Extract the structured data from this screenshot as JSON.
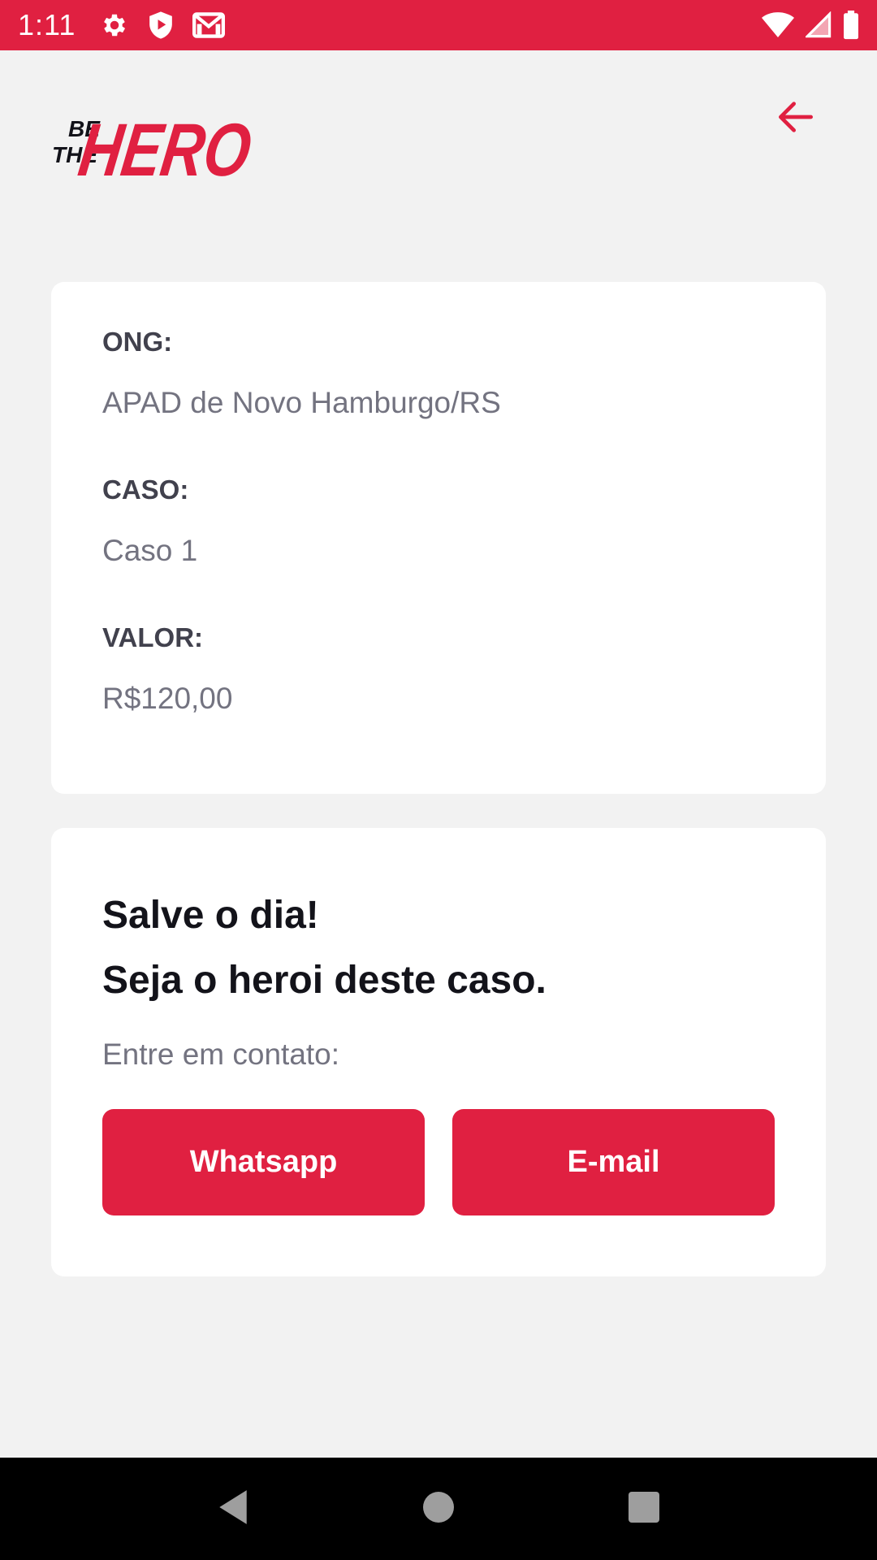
{
  "status_bar": {
    "time": "1:11",
    "icons_left": [
      "gear-icon",
      "shield-play-icon",
      "gmail-icon"
    ],
    "icons_right": [
      "wifi-icon",
      "signal-icon",
      "battery-icon"
    ]
  },
  "header": {
    "logo_text_small_top": "BE",
    "logo_text_small_bottom": "THE",
    "logo_text_large": "HERO",
    "back_icon": "arrow-left-icon"
  },
  "incident": {
    "ong_label": "ONG:",
    "ong_value": "APAD de Novo Hamburgo/RS",
    "case_label": "CASO:",
    "case_value": "Caso 1",
    "value_label": "VALOR:",
    "value_value": "R$120,00"
  },
  "contact": {
    "title_line1": "Salve o dia!",
    "title_line2": "Seja o heroi deste caso.",
    "subtitle": "Entre em contato:",
    "whatsapp_label": "Whatsapp",
    "email_label": "E-mail"
  },
  "colors": {
    "accent": "#e02041",
    "background": "#f2f2f2",
    "card": "#ffffff",
    "label": "#41414d",
    "value": "#737380",
    "title": "#13131a"
  },
  "nav_bar": {
    "icons": [
      "back-triangle-icon",
      "home-circle-icon",
      "recents-square-icon"
    ]
  }
}
